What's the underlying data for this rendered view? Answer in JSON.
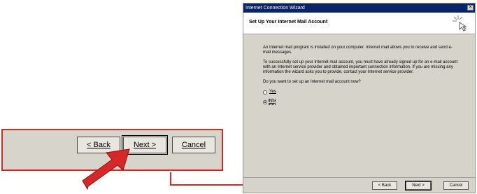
{
  "callout": {
    "back_label": "< Back",
    "next_label": "Next >",
    "cancel_label": "Cancel"
  },
  "wizard": {
    "window_title": "Internet Connection Wizard",
    "close_glyph": "×",
    "header_title": "Set Up Your Internet Mail Account",
    "paragraph1": "An Internet mail program is installed on your computer. Internet mail allows you to receive and send e-mail messages.",
    "paragraph2": "To successfully set up your Internet mail account, you must have already signed up for an e-mail account with an Internet service provider and obtained important connection information. If you are missing any information the wizard asks you to provide, contact your Internet service provider.",
    "question": "Do you want to set up an Internet mail account now?",
    "options": [
      {
        "label": "Yes",
        "selected": false
      },
      {
        "label": "No",
        "selected": true
      }
    ],
    "back_label": "< Back",
    "next_label": "Next >",
    "cancel_label": "Cancel"
  },
  "colors": {
    "accent_red": "#d62828",
    "titlebar_blue": "#0a246a"
  }
}
